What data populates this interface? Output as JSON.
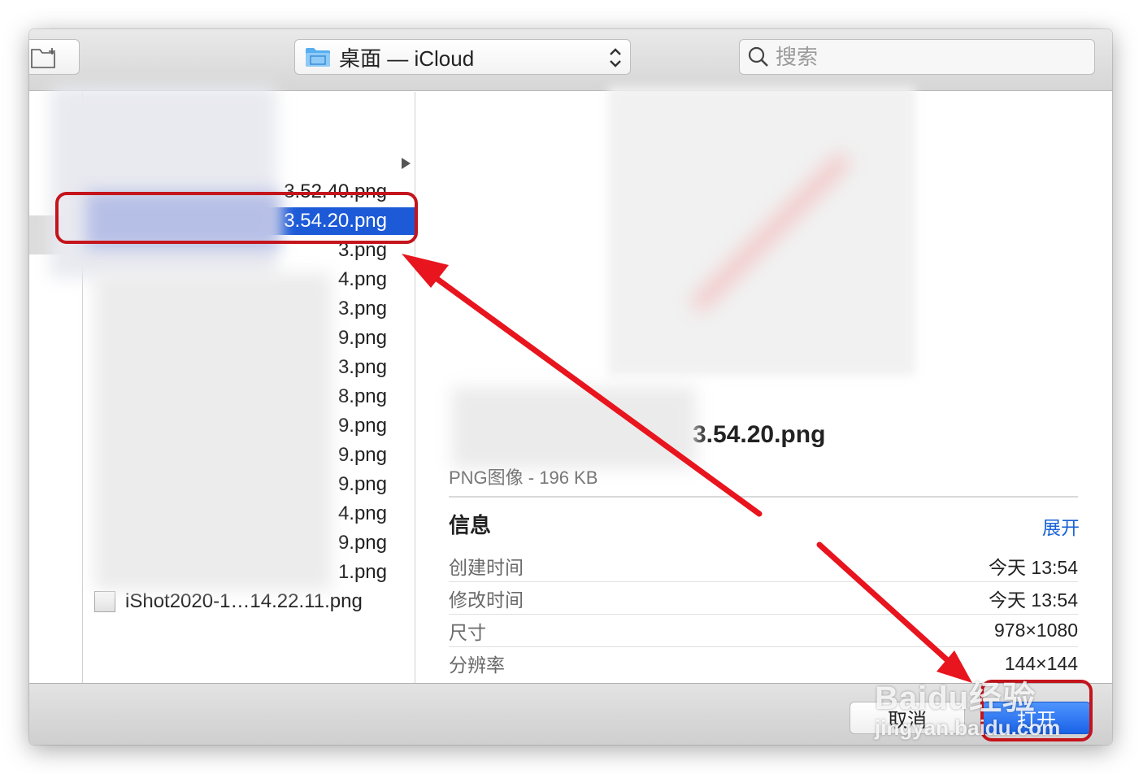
{
  "toolbar": {
    "location": "桌面 — iCloud",
    "search_placeholder": "搜索"
  },
  "file_list": {
    "items": [
      {
        "name": "3.52.40.png"
      },
      {
        "name": "3.54.20.png",
        "selected": true
      },
      {
        "name": "3.png"
      },
      {
        "name": "4.png"
      },
      {
        "name": "3.png"
      },
      {
        "name": "9.png"
      },
      {
        "name": "3.png"
      },
      {
        "name": "8.png"
      },
      {
        "name": "9.png"
      },
      {
        "name": "9.png"
      },
      {
        "name": "9.png"
      },
      {
        "name": "4.png"
      },
      {
        "name": "9.png"
      },
      {
        "name": "1.png"
      }
    ],
    "last_item": "iShot2020-1…14.22.11.png"
  },
  "preview": {
    "file_name": "3.54.20.png",
    "kind_size": "PNG图像 - 196 KB",
    "info_heading": "信息",
    "expand_label": "展开",
    "info_rows": [
      {
        "label": "创建时间",
        "value": "今天 13:54"
      },
      {
        "label": "修改时间",
        "value": "今天 13:54"
      },
      {
        "label": "尺寸",
        "value": "978×1080"
      },
      {
        "label": "分辨率",
        "value": "144×144"
      }
    ]
  },
  "buttons": {
    "cancel": "取消",
    "open": "打开"
  },
  "watermark": {
    "main": "Baidu经验",
    "sub": "jingyan.baidu.com"
  },
  "colors": {
    "selection": "#1c5ad8",
    "annotation_red": "#c4141c",
    "link_blue": "#1a62d6"
  }
}
